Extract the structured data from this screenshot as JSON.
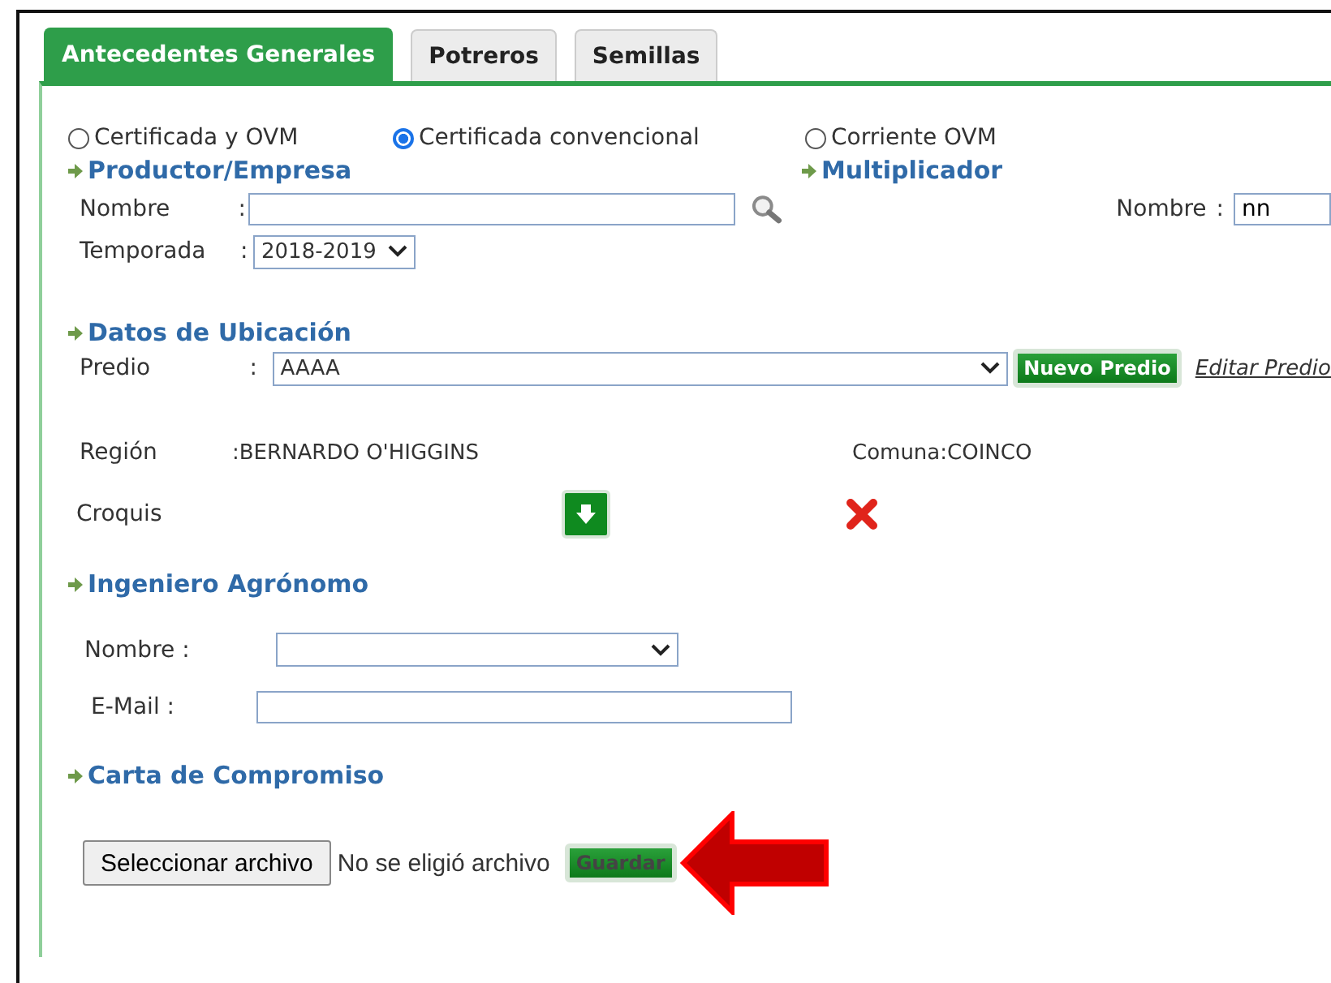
{
  "tabs": [
    {
      "label": "Antecedentes Generales",
      "selected": true
    },
    {
      "label": "Potreros",
      "selected": false
    },
    {
      "label": "Semillas",
      "selected": false
    }
  ],
  "certification_options": [
    {
      "label": "Certificada y OVM",
      "selected": false
    },
    {
      "label": "Certificada convencional",
      "selected": true
    },
    {
      "label": "Corriente OVM",
      "selected": false
    }
  ],
  "productor": {
    "heading": "Productor/Empresa",
    "name_label": "Nombre",
    "colon": ":",
    "season_label": "Temporada",
    "season_value": "2018-2019"
  },
  "multiplicador": {
    "heading": "Multiplicador",
    "name_label": "Nombre",
    "colon": ":",
    "name_value": "nn"
  },
  "ubicacion": {
    "heading": "Datos de Ubicación",
    "predio_label": "Predio",
    "colon": ":",
    "predio_value": "AAAA",
    "new_button": "Nuevo Predio",
    "edit_link": "Editar Predio",
    "region_label": "Región",
    "region_value": ":BERNARDO O'HIGGINS",
    "comuna_label": "Comuna:",
    "comuna_value": "COINCO",
    "sketch_label": "Croquis"
  },
  "ingeniero": {
    "heading": "Ingeniero Agrónomo",
    "name_label": "Nombre :",
    "email_label": "E-Mail :"
  },
  "carta": {
    "heading": "Carta de Compromiso",
    "file_button": "Seleccionar archivo",
    "file_status": "No se eligió archivo",
    "save_button": "Guardar"
  }
}
